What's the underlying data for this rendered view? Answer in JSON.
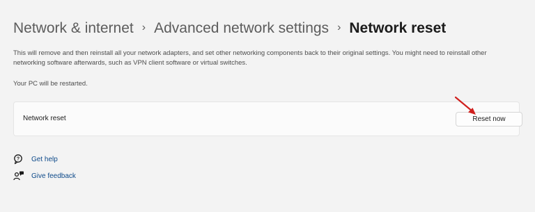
{
  "breadcrumb": {
    "level1": "Network & internet",
    "level2": "Advanced network settings",
    "current": "Network reset",
    "separator": "›"
  },
  "description": "This will remove and then reinstall all your network adapters, and set other networking components back to their original settings. You might need to reinstall other networking software afterwards, such as VPN client software or virtual switches.",
  "restart_notice": "Your PC will be restarted.",
  "reset_card": {
    "label": "Network reset",
    "button_label": "Reset now"
  },
  "links": {
    "help": "Get help",
    "feedback": "Give feedback"
  },
  "colors": {
    "background": "#f3f3f3",
    "link": "#0e4a8a",
    "annotation_arrow": "#d0201e"
  },
  "icons": {
    "help": "help-chat-icon",
    "feedback": "feedback-person-icon",
    "annotation": "red-arrow-icon"
  }
}
